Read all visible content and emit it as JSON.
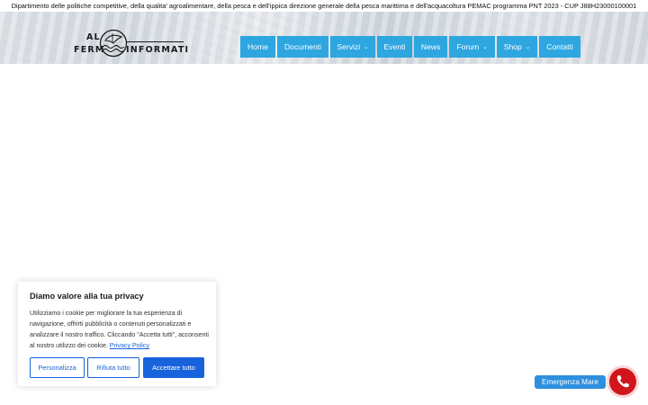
{
  "topbar": {
    "text": "Dipartimento delle politiche competitive, della qualita' agroalimentare, della pesca e dell'ippica direzione generale della pesca marittima e dell'acquacoltura PEMAC programma PNT 2023 - CUP J88H23000100001"
  },
  "logo": {
    "line1": "AL",
    "line2_left": "FERM",
    "line2_right": "INFORMATI"
  },
  "nav": {
    "items": [
      {
        "label": "Home"
      },
      {
        "label": "Documenti"
      },
      {
        "label": "Servizi",
        "icon": "chevron-down-icon"
      },
      {
        "label": "Eventi"
      },
      {
        "label": "News"
      },
      {
        "label": "Forum",
        "icon": "chevron-down-icon"
      },
      {
        "label": "Shop",
        "icon": "chevron-down-icon"
      },
      {
        "label": "Contatti"
      }
    ],
    "color": "#2ea6df"
  },
  "cookie": {
    "title": "Diamo valore alla tua privacy",
    "body": "Utilizziamo i cookie per migliorare la tua esperienza di navigazione, offrirti pubblicità o contenuti personalizzati e analizzare il nostro traffico. Cliccando “Accetta tutti”, acconsenti al nostro utilizzo dei cookie.",
    "policy_link": "Privacy Policy",
    "buttons": {
      "customize": "Personalizza",
      "reject": "Rifiuta tutto",
      "accept": "Accettare tutto"
    },
    "accent": "#1863dc"
  },
  "emergency": {
    "label": "Emergenza Mare",
    "icon": "phone-icon",
    "color": "#d0151c"
  }
}
